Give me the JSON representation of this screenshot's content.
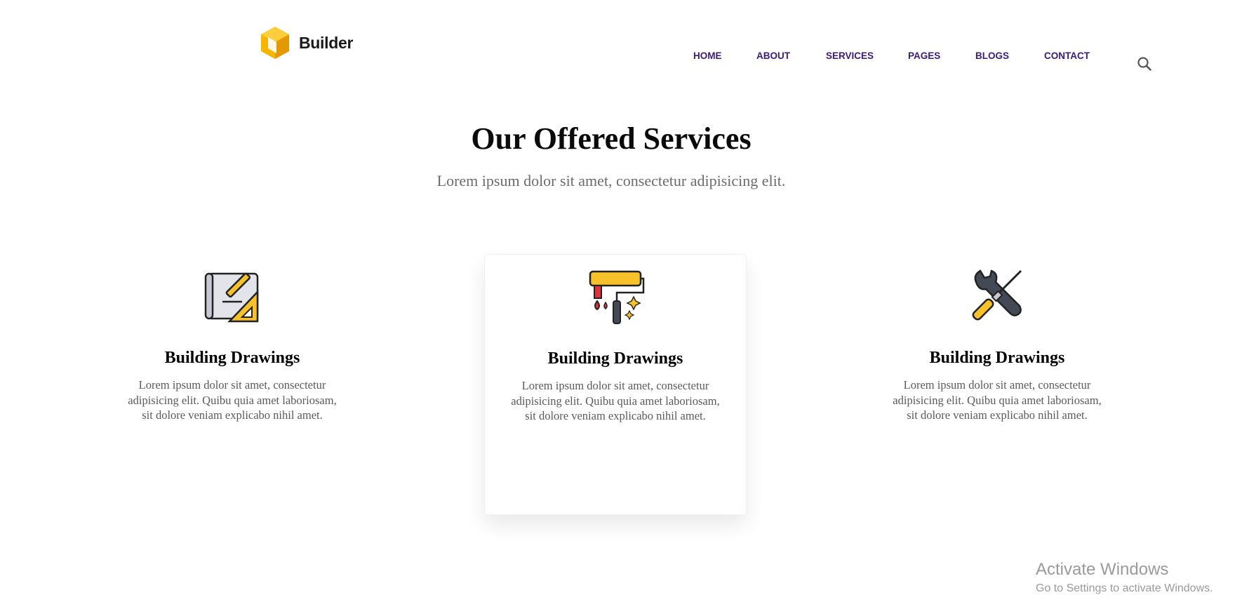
{
  "header": {
    "logo_text": "Builder",
    "nav": [
      {
        "label": "HOME"
      },
      {
        "label": "ABOUT"
      },
      {
        "label": "SERVICES"
      },
      {
        "label": "PAGES"
      },
      {
        "label": "BLOGS"
      },
      {
        "label": "CONTACT"
      }
    ],
    "search_icon": "search-icon"
  },
  "section": {
    "title": "Our Offered Services",
    "subtitle": "Lorem ipsum dolor sit amet, consectetur adipisicing elit."
  },
  "services": [
    {
      "icon": "blueprint-icon",
      "title": "Building Drawings",
      "text": "Lorem ipsum dolor sit amet, consectetur adipisicing elit. Quibu quia amet laboriosam, sit dolore veniam explicabo nihil amet."
    },
    {
      "icon": "paint-roller-icon",
      "title": "Building Drawings",
      "text": "Lorem ipsum dolor sit amet, consectetur adipisicing elit. Quibu quia amet laboriosam, sit dolore veniam explicabo nihil amet."
    },
    {
      "icon": "tools-icon",
      "title": "Building Drawings",
      "text": "Lorem ipsum dolor sit amet, consectetur adipisicing elit. Quibu quia amet laboriosam, sit dolore veniam explicabo nihil amet."
    }
  ],
  "watermark": {
    "line1": "Activate Windows",
    "line2": "Go to Settings to activate Windows."
  },
  "colors": {
    "nav": "#3a1a7a",
    "logo_accent": "#f7b500",
    "title": "#0b0b0b",
    "body_text": "#5a5a5a"
  }
}
